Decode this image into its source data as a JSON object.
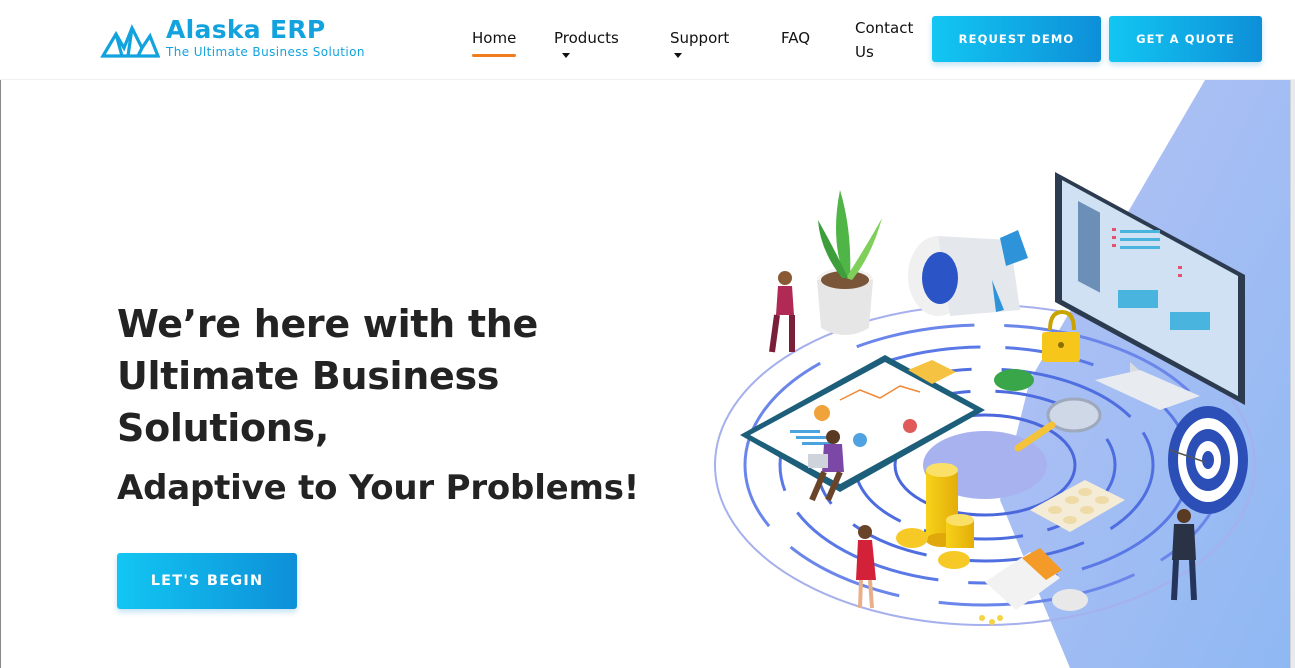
{
  "brand": {
    "name": "Alaska ERP",
    "tagline": "The Ultimate Business Solution"
  },
  "nav": {
    "home": "Home",
    "products": "Products",
    "support": "Support",
    "faq": "FAQ",
    "contact": "Contact Us",
    "active": "Home"
  },
  "actions": {
    "request_demo": "REQUEST DEMO",
    "get_quote": "GET A QUOTE"
  },
  "hero": {
    "title": "We’re here with the Ultimate Business Solutions,",
    "subtitle": "Adaptive to Your Problems!",
    "cta": "LET'S BEGIN"
  },
  "colors": {
    "brand_blue": "#12a3de",
    "button_gradient_start": "#12c6f2",
    "button_gradient_end": "#0e8fd8",
    "active_underline": "#f07c1b",
    "illustration_bg": "#a9b8f2"
  },
  "icons": {
    "logo": "mountain-logo-icon",
    "dropdown": "caret-down-icon"
  }
}
